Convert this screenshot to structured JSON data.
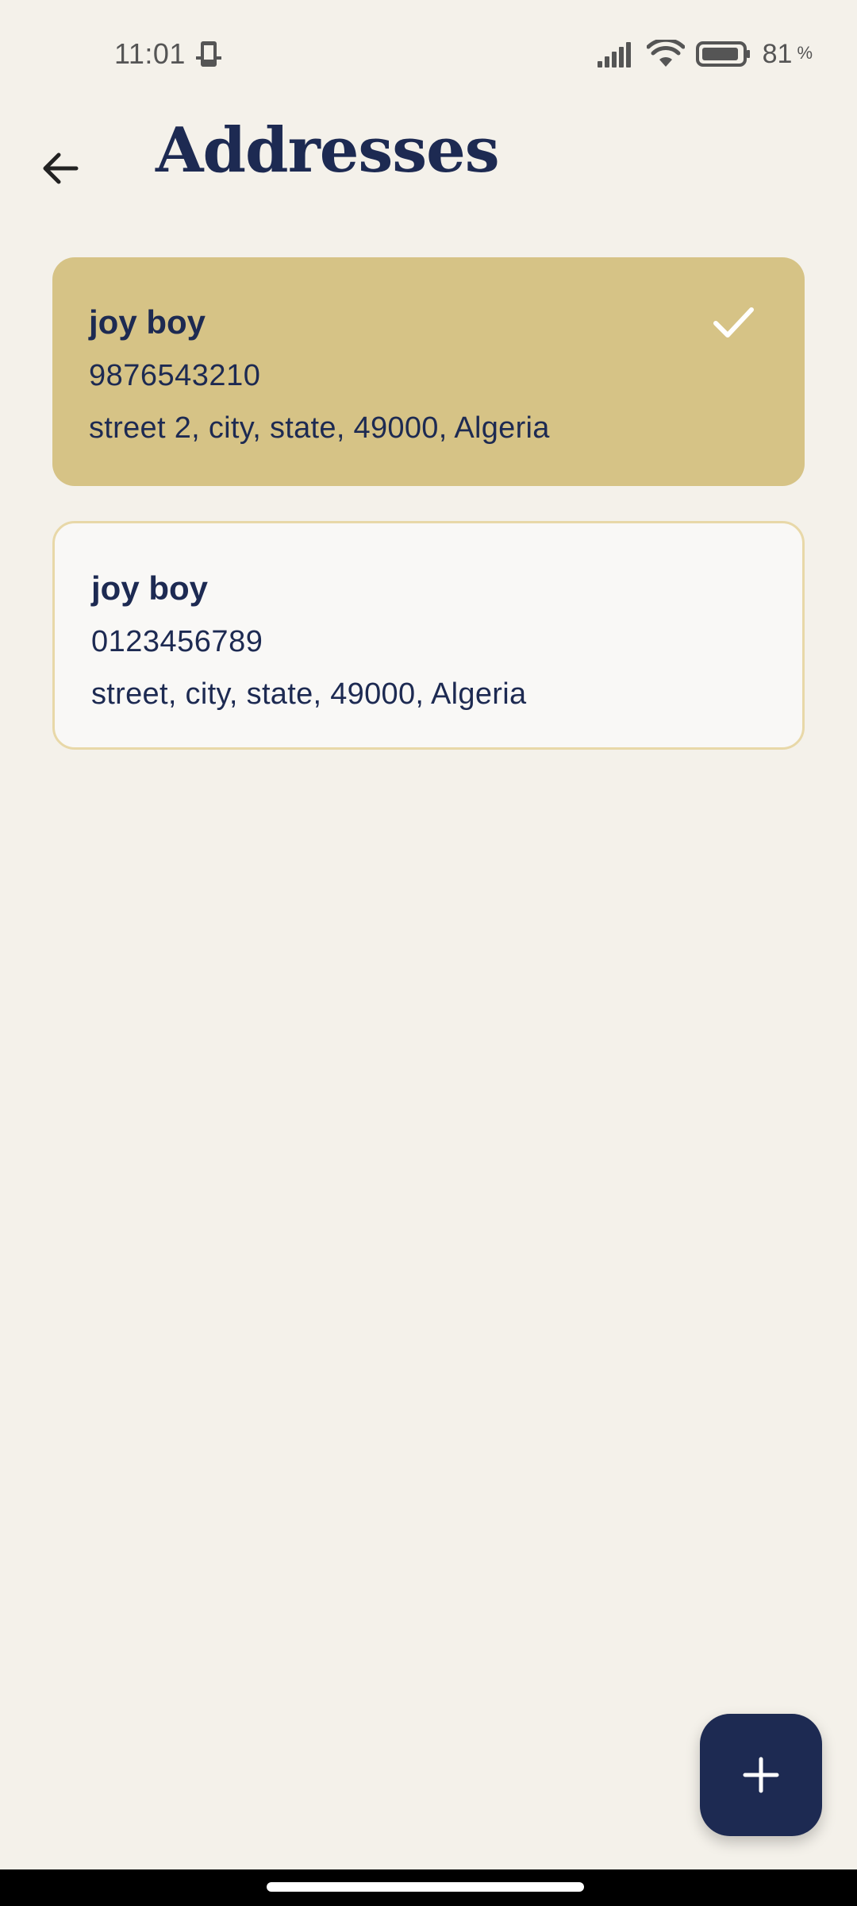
{
  "status_bar": {
    "time": "11:01",
    "battery_percent": "81",
    "battery_suffix": "%",
    "icons": [
      "notification-phone-icon",
      "signal-icon",
      "wifi-icon",
      "battery-icon"
    ]
  },
  "app_bar": {
    "title": "Addresses",
    "back_icon": "arrow-back-icon"
  },
  "addresses": [
    {
      "name": "joy boy",
      "phone": "9876543210",
      "address": "street 2, city, state, 49000, Algeria",
      "selected": true
    },
    {
      "name": "joy boy",
      "phone": "0123456789",
      "address": "street, city, state, 49000, Algeria",
      "selected": false
    }
  ],
  "fab": {
    "icon": "plus-icon"
  },
  "colors": {
    "background": "#f4f1ea",
    "primary": "#1d2a52",
    "selected_card": "#d6c386",
    "card_border": "#e8d8a8"
  }
}
